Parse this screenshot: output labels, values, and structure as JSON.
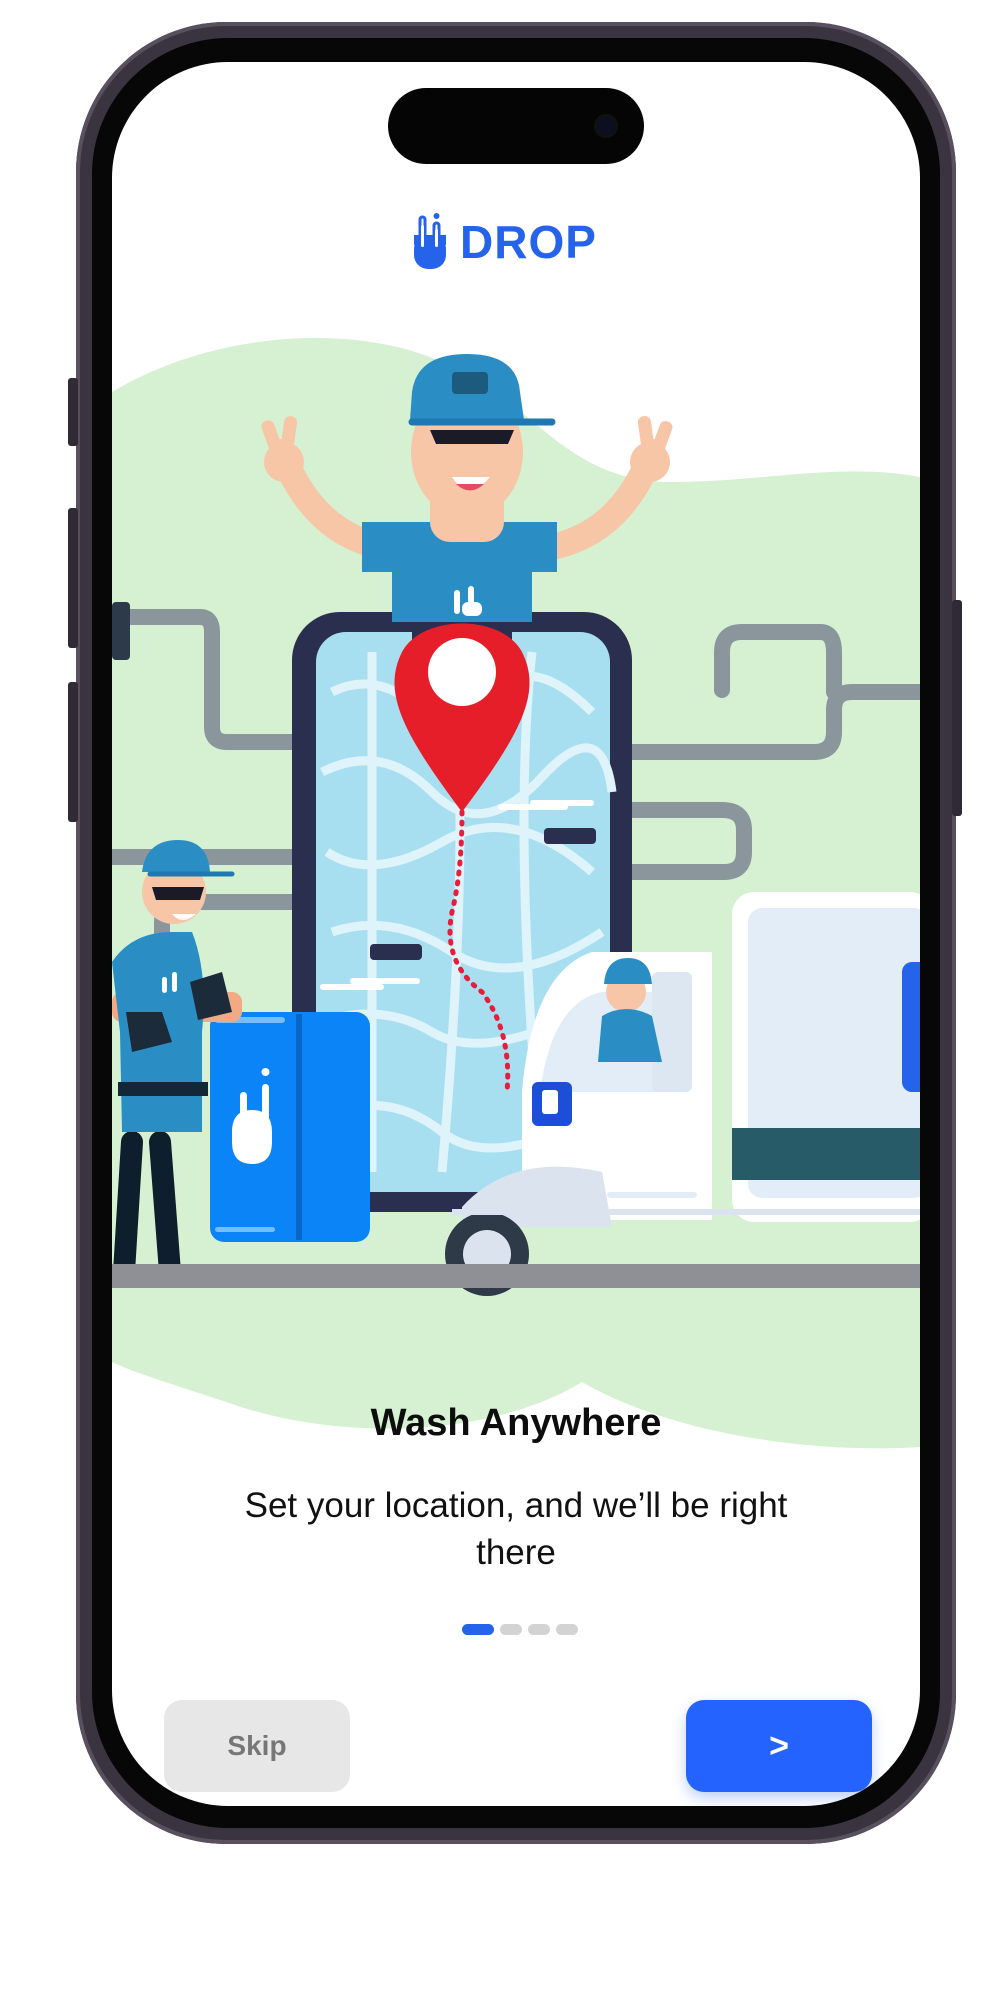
{
  "app": {
    "brand_name": "DROP",
    "brand_color": "#2563eb"
  },
  "onboarding": {
    "title": "Wash Anywhere",
    "subtitle": "Set your location, and we’ll be right there",
    "current_page": 1,
    "total_pages": 4
  },
  "actions": {
    "skip_label": "Skip",
    "next_label": ">"
  },
  "icons": {
    "logo": "drop-logo-icon",
    "illustration": "car-wash-delivery-illustration"
  }
}
